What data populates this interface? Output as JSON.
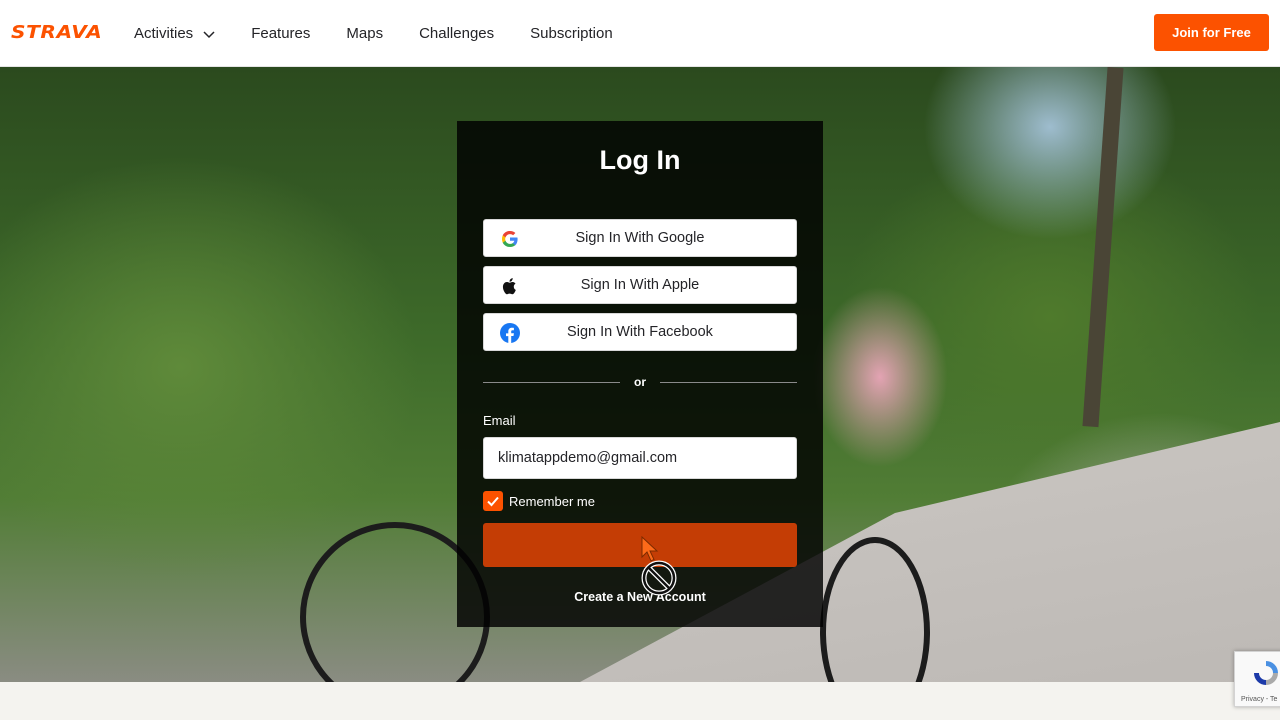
{
  "header": {
    "logo": "STRAVA",
    "nav": [
      {
        "label": "Activities",
        "has_dropdown": true
      },
      {
        "label": "Features"
      },
      {
        "label": "Maps"
      },
      {
        "label": "Challenges"
      },
      {
        "label": "Subscription"
      }
    ],
    "join_label": "Join for Free"
  },
  "login": {
    "title": "Log In",
    "google_label": "Sign In With Google",
    "apple_label": "Sign In With Apple",
    "facebook_label": "Sign In With Facebook",
    "divider_text": "or",
    "email_label": "Email",
    "email_value": "klimatappdemo@gmail.com",
    "remember_label": "Remember me",
    "remember_checked": true,
    "create_account_label": "Create a New Account"
  },
  "recaptcha": {
    "text": "Privacy - Te"
  },
  "colors": {
    "brand": "#fc5200",
    "submit": "#c43d05",
    "card_bg": "rgba(0,0,0,0.82)"
  },
  "icons": [
    "chevron-down-icon",
    "google-icon",
    "apple-icon",
    "facebook-icon",
    "checkmark-icon",
    "mouse-cursor-icon",
    "not-allowed-icon",
    "recaptcha-icon"
  ]
}
